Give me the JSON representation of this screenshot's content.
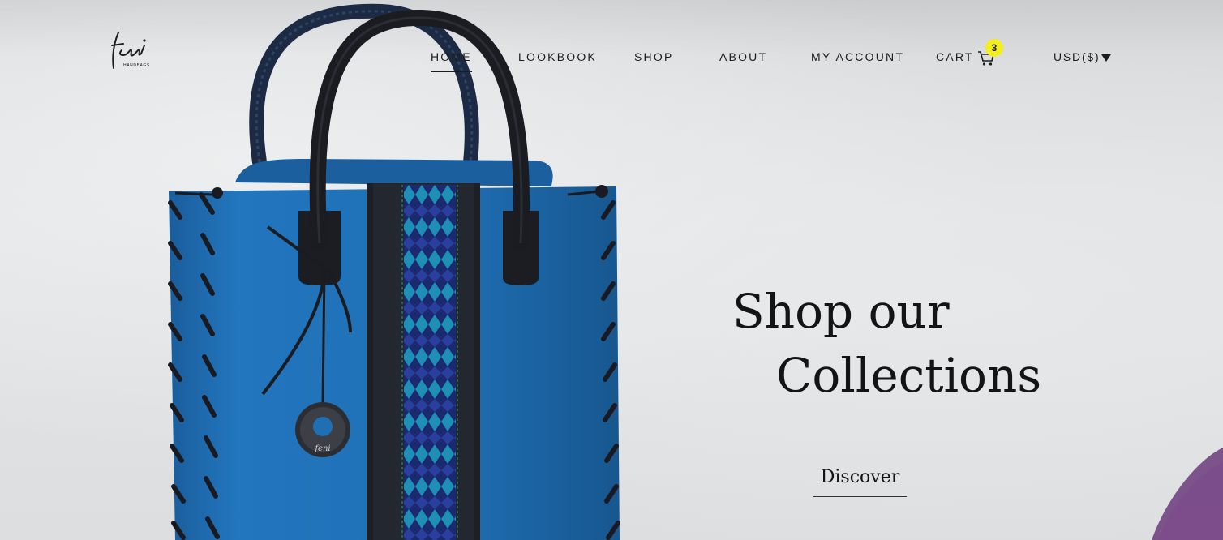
{
  "brand": {
    "logo_icon": "feni-handbags-logo"
  },
  "nav": {
    "items": [
      {
        "label": "HOME",
        "active": true
      },
      {
        "label": "LOOKBOOK",
        "active": false
      },
      {
        "label": "SHOP",
        "active": false
      },
      {
        "label": "ABOUT",
        "active": false
      },
      {
        "label": "MY ACCOUNT",
        "active": false
      },
      {
        "label": "CART",
        "active": false
      }
    ],
    "cart_icon": "shopping-cart-icon",
    "cart_count": "3",
    "currency": "USD($)",
    "currency_icon": "caret-down-icon"
  },
  "hero": {
    "headline_line1": "Shop our",
    "headline_line2": "Collections",
    "cta_label": "Discover"
  },
  "colors": {
    "bag_blue": "#1f6fb5",
    "badge_yellow": "#f3ee1c",
    "text_dark": "#1c1c1c"
  }
}
